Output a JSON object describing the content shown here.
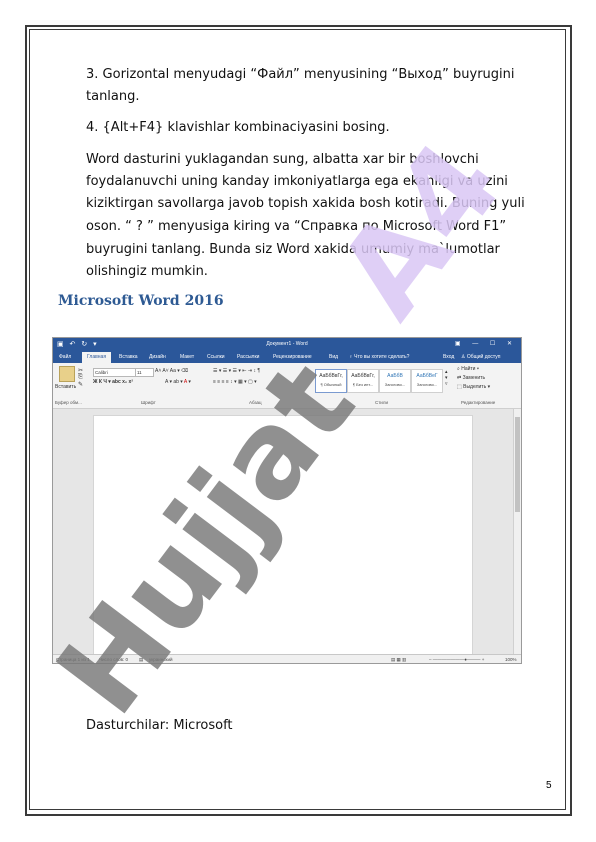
{
  "doc": {
    "item3": "3.    Gorizontal menyudagi “Файл” menyusining “Выход” buyrugini tanlang.",
    "item4": "4.    {Alt+F4} klavishlar kombinaciyasini bosing.",
    "para_lines": [
      "Word  dasturini yuklagandan sung, albatta xar bir boshlovchi",
      "foydalanuvchi uning kanday imkoniyatlarga ega ekanligi va uzini",
      "kiziktirgan savollarga javob topish xakida bosh kotiradi. Buning yuli",
      "oson. “ ? ” menyusiga kiring va “Справка по Microsoft Word F1”",
      "buyrugini tanlang. Bunda siz Word xakida umumiy ma`lumotlar",
      "olishingiz mumkin."
    ],
    "heading": "Microsoft Word 2016",
    "footer_line": "Dasturchilar: Microsoft",
    "page_number": "5"
  },
  "word_ui": {
    "window_title": "Документ1 - Word",
    "tabs": [
      "Файл",
      "Главная",
      "Вставка",
      "Дизайн",
      "Макет",
      "Ссылки",
      "Рассылки",
      "Рецензирование",
      "Вид"
    ],
    "tell_me": "Что вы хотите сделать?",
    "sign_in": "Вход",
    "share": "Общий доступ",
    "paste_label": "Вставить",
    "font_name": "Calibri",
    "font_size": "11",
    "styles": [
      {
        "sample": "АаБбВвГг,",
        "name": "¶ Обычный"
      },
      {
        "sample": "АаБбВвГг,",
        "name": "¶ Без инт..."
      },
      {
        "sample": "АаБбВ",
        "name": "Заголово..."
      },
      {
        "sample": "АаБбВеГ",
        "name": "Заголово..."
      }
    ],
    "find": "Найти",
    "replace": "Заменить",
    "select": "Выделить",
    "groups": [
      "Буфер обм...",
      "Шрифт",
      "Абзац",
      "Стили",
      "Редактирование"
    ],
    "status_page": "Страница 1 из 1",
    "status_words": "Число слов: 0",
    "status_lang": "украинский",
    "zoom": "100%"
  },
  "watermark": {
    "text1": "Hujjat",
    "text2": "A4",
    "color_text1": "#777777",
    "color_text2": "#d9c7f5"
  }
}
